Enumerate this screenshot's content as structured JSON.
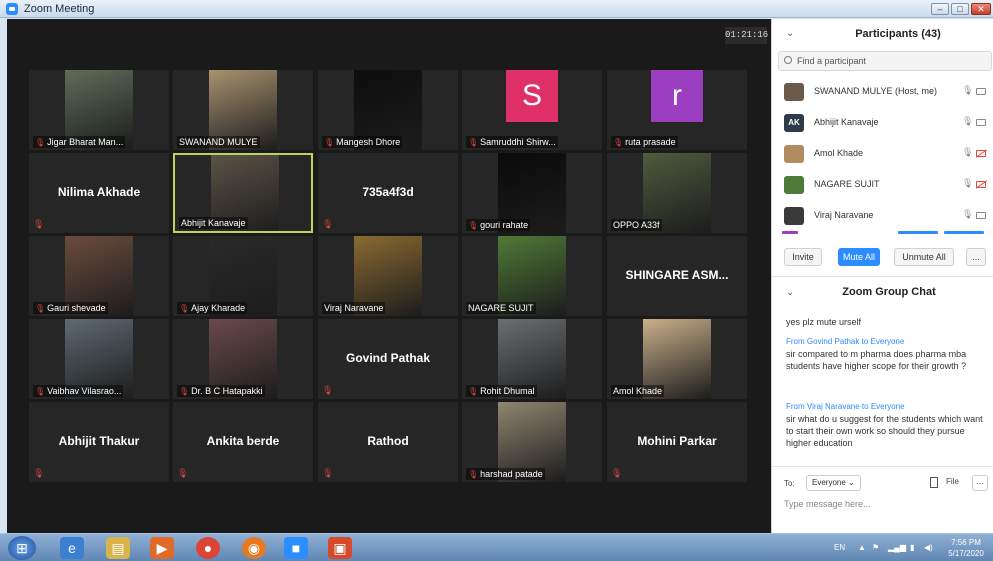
{
  "window": {
    "title": "Zoom Meeting"
  },
  "meeting": {
    "timer": "01:21:16"
  },
  "tiles": [
    {
      "name": "Jigar Bharat Man...",
      "muted": true,
      "type": "video",
      "bg": "#5d6d58"
    },
    {
      "name": "SWANAND MULYE",
      "muted": false,
      "type": "video",
      "bg": "#a89270"
    },
    {
      "name": "Mangesh Dhore",
      "muted": true,
      "type": "video",
      "bg": "#0d0d0d"
    },
    {
      "name": "Samruddhi Shirw...",
      "muted": true,
      "type": "avatar",
      "letter": "S",
      "bg": "#e0306a"
    },
    {
      "name": "ruta prasade",
      "muted": true,
      "type": "avatar",
      "letter": "r",
      "bg": "#9b3fc0"
    },
    {
      "name": "Nilima Akhade",
      "muted": true,
      "type": "name"
    },
    {
      "name": "Abhijit Kanavaje",
      "muted": false,
      "type": "video",
      "bg": "#5a5245",
      "active": true
    },
    {
      "name": "735a4f3d",
      "muted": true,
      "type": "name"
    },
    {
      "name": "gouri rahate",
      "muted": true,
      "type": "video",
      "bg": "#0a0a0a"
    },
    {
      "name": "OPPO A33f",
      "muted": false,
      "type": "video",
      "bg": "#4f5b3d"
    },
    {
      "name": "Gauri shevade",
      "muted": true,
      "type": "video",
      "bg": "#6b4c3c"
    },
    {
      "name": "Ajay Kharade",
      "muted": true,
      "type": "video",
      "bg": "#2a2a2a"
    },
    {
      "name": "Viraj Naravane",
      "muted": false,
      "type": "video",
      "bg": "#8a6a32"
    },
    {
      "name": "NAGARE SUJIT",
      "muted": false,
      "type": "video",
      "bg": "#4f7a36"
    },
    {
      "name": "SHINGARE ASM...",
      "muted": false,
      "type": "name"
    },
    {
      "name": "Vaibhav Vilasrao...",
      "muted": true,
      "type": "video",
      "bg": "#5e6a72"
    },
    {
      "name": "Dr. B C Hatapakki",
      "muted": true,
      "type": "video",
      "bg": "#6a4a4a"
    },
    {
      "name": "Govind Pathak",
      "muted": true,
      "type": "name"
    },
    {
      "name": "Rohit Dhumal",
      "muted": true,
      "type": "video",
      "bg": "#6b6e72"
    },
    {
      "name": "Amol Khade",
      "muted": false,
      "type": "video",
      "bg": "#c9b08a"
    },
    {
      "name": "Abhijit Thakur",
      "muted": true,
      "type": "name"
    },
    {
      "name": "Ankita berde",
      "muted": true,
      "type": "name"
    },
    {
      "name": "Rathod",
      "muted": true,
      "type": "name"
    },
    {
      "name": "harshad patade",
      "muted": true,
      "type": "video",
      "bg": "#8f8670"
    },
    {
      "name": "Mohini Parkar",
      "muted": true,
      "type": "name"
    }
  ],
  "participants_panel": {
    "title": "Participants (43)",
    "search_placeholder": "Find a participant",
    "list": [
      {
        "name": "SWANAND MULYE (Host, me)",
        "avatar": "",
        "avatar_color": "#6b5a4a",
        "mic_off": false,
        "cam_off": false
      },
      {
        "name": "Abhijit Kanavaje",
        "avatar": "AK",
        "avatar_color": "#2f3b4a",
        "mic_off": false,
        "cam_off": false
      },
      {
        "name": "Amol Khade",
        "avatar": "",
        "avatar_color": "#b38b60",
        "mic_off": false,
        "cam_off": true
      },
      {
        "name": "NAGARE SUJIT",
        "avatar": "",
        "avatar_color": "#4e7a3a",
        "mic_off": false,
        "cam_off": true
      },
      {
        "name": "Viraj Naravane",
        "avatar": "",
        "avatar_color": "#3a3a3a",
        "mic_off": false,
        "cam_off": false
      }
    ],
    "invite_label": "Invite",
    "mute_all_label": "Mute All",
    "unmute_all_label": "Unmute All",
    "more_label": "..."
  },
  "chat": {
    "title": "Zoom Group Chat",
    "messages": [
      {
        "from": "",
        "to": "",
        "text": "yes plz mute urself"
      },
      {
        "from": "Govind Pathak",
        "to": "Everyone",
        "text": "sir compared to m pharma does pharma mba students have higher scope for their growth ?"
      },
      {
        "from": "Viraj Naravane",
        "to": "Everyone",
        "text": "sir what do u suggest for the students which want to start their own work so should they pursue higher education"
      }
    ],
    "from_word": "From",
    "to_word": "to",
    "to_label": "To:",
    "to_value": "Everyone",
    "file_label": "File",
    "more_label": "...",
    "input_placeholder": "Type message here..."
  },
  "taskbar": {
    "lang": "EN",
    "time": "7:56 PM",
    "date": "5/17/2020"
  }
}
